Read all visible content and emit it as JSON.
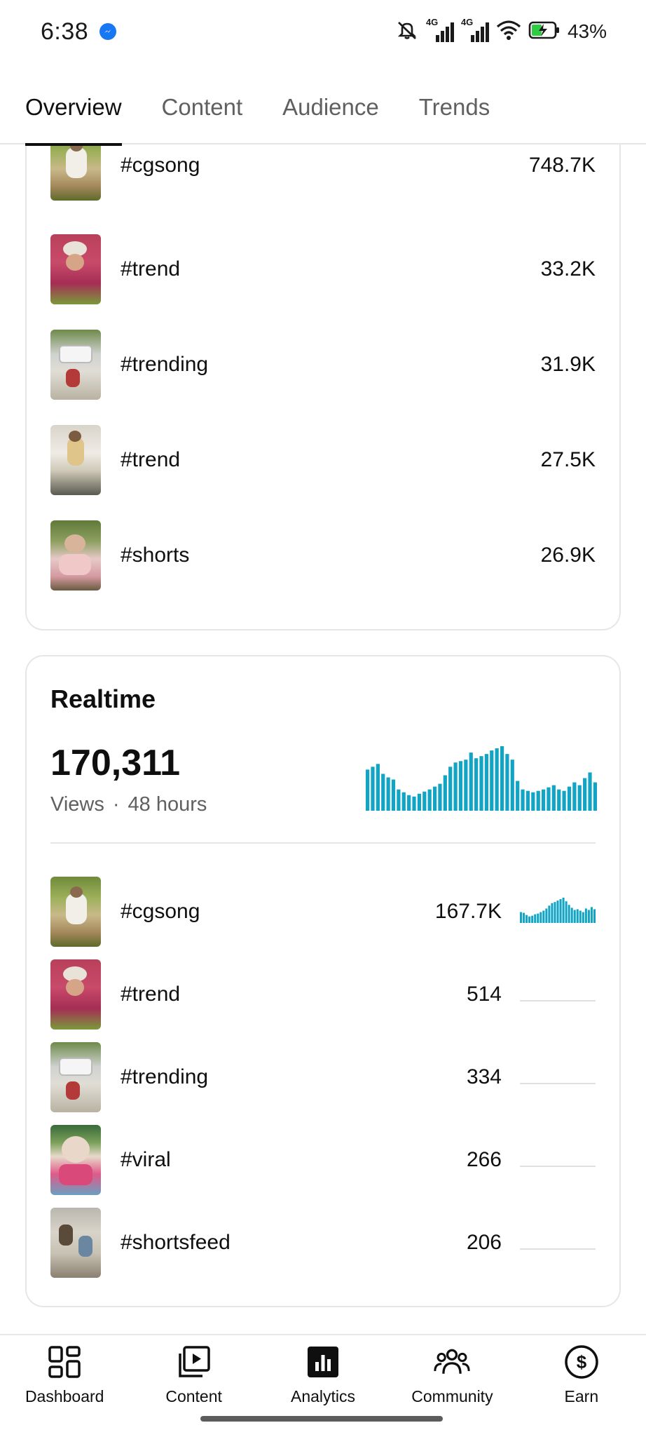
{
  "status_bar": {
    "time": "6:38",
    "battery_percent": "43%",
    "network_1": "4G",
    "network_2": "4G",
    "icons": [
      "messenger-icon",
      "mute-icon",
      "signal-icon",
      "signal-icon",
      "wifi-icon",
      "battery-charging-icon"
    ]
  },
  "tabs": [
    {
      "label": "Overview",
      "active": true
    },
    {
      "label": "Content",
      "active": false
    },
    {
      "label": "Audience",
      "active": false
    },
    {
      "label": "Trends",
      "active": false
    }
  ],
  "top_list": [
    {
      "label": "#cgsong",
      "value": "748.7K"
    },
    {
      "label": "#trend",
      "value": "33.2K"
    },
    {
      "label": "#trending",
      "value": "31.9K"
    },
    {
      "label": "#trend",
      "value": "27.5K"
    },
    {
      "label": "#shorts",
      "value": "26.9K"
    }
  ],
  "realtime": {
    "title": "Realtime",
    "views": "170,311",
    "views_label": "Views",
    "separator": "·",
    "period": "48 hours",
    "accent_color": "#12a4c4",
    "chart_data": {
      "type": "bar",
      "values": [
        58,
        62,
        66,
        52,
        47,
        44,
        30,
        26,
        22,
        20,
        24,
        27,
        30,
        34,
        38,
        50,
        62,
        68,
        70,
        72,
        82,
        74,
        77,
        80,
        85,
        88,
        91,
        80,
        72,
        42,
        30,
        28,
        26,
        28,
        30,
        33,
        36,
        30,
        28,
        34,
        40,
        36,
        46,
        54,
        40
      ]
    },
    "items": [
      {
        "label": "#cgsong",
        "value": "167.7K",
        "has_spark": true
      },
      {
        "label": "#trend",
        "value": "514",
        "has_spark": false
      },
      {
        "label": "#trending",
        "value": "334",
        "has_spark": false
      },
      {
        "label": "#viral",
        "value": "266",
        "has_spark": false
      },
      {
        "label": "#shortsfeed",
        "value": "206",
        "has_spark": false
      }
    ],
    "spark_data": {
      "type": "bar",
      "values": [
        30,
        28,
        22,
        18,
        20,
        24,
        26,
        30,
        34,
        40,
        48,
        55,
        58,
        62,
        66,
        70,
        60,
        50,
        42,
        36,
        38,
        34,
        30,
        40,
        36,
        44,
        38
      ]
    }
  },
  "bottom_nav": [
    {
      "label": "Dashboard",
      "icon": "dashboard-icon"
    },
    {
      "label": "Content",
      "icon": "content-icon"
    },
    {
      "label": "Analytics",
      "icon": "analytics-icon"
    },
    {
      "label": "Community",
      "icon": "community-icon"
    },
    {
      "label": "Earn",
      "icon": "earn-icon"
    }
  ]
}
